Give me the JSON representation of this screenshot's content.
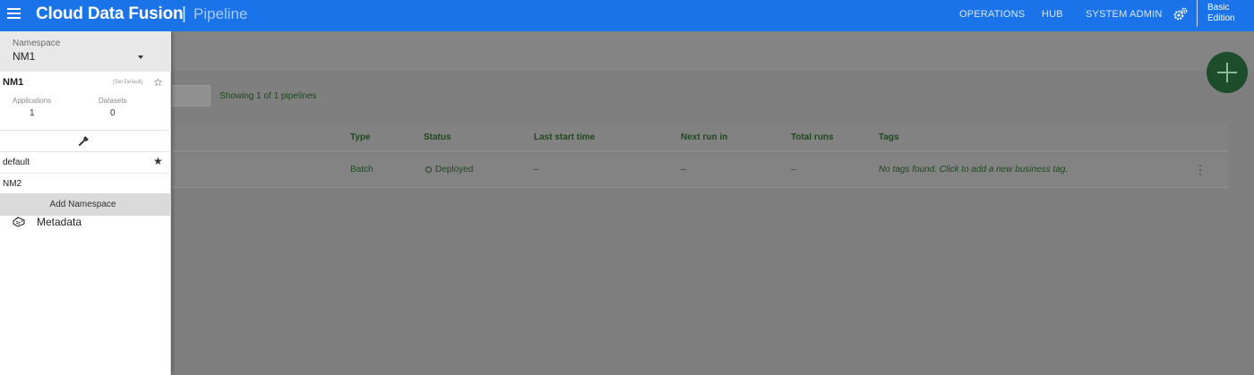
{
  "topbar": {
    "brand": "Cloud Data Fusion",
    "separator": "|",
    "section": "Pipeline",
    "nav": [
      "OPERATIONS",
      "HUB",
      "SYSTEM ADMIN"
    ],
    "edition": [
      "Basic",
      "Edition"
    ],
    "icons": [
      "menu-icon",
      "gear-icon"
    ],
    "color": "#1a73e8"
  },
  "drawer": {
    "namespace_label": "Namespace",
    "current_namespace": "NM1",
    "card": {
      "name": "NM1",
      "set_default": "(Set Default)",
      "applications_label": "Applications",
      "applications_value": "1",
      "datasets_label": "Datasets",
      "datasets_value": "0"
    },
    "namespaces": [
      {
        "name": "default",
        "starred": true
      },
      {
        "name": "NM2",
        "starred": false
      }
    ],
    "add_namespace": "Add Namespace",
    "metadata": "Metadata"
  },
  "main": {
    "showing": "Showing 1 of 1 pipelines",
    "columns": [
      "Type",
      "Status",
      "Last start time",
      "Next run in",
      "Total runs",
      "Tags"
    ],
    "rows": [
      {
        "type": "Batch",
        "status": "Deployed",
        "last_start": "–",
        "next_run": "–",
        "total_runs": "–",
        "tags": "No tags found. Click to add a new business tag."
      }
    ]
  }
}
